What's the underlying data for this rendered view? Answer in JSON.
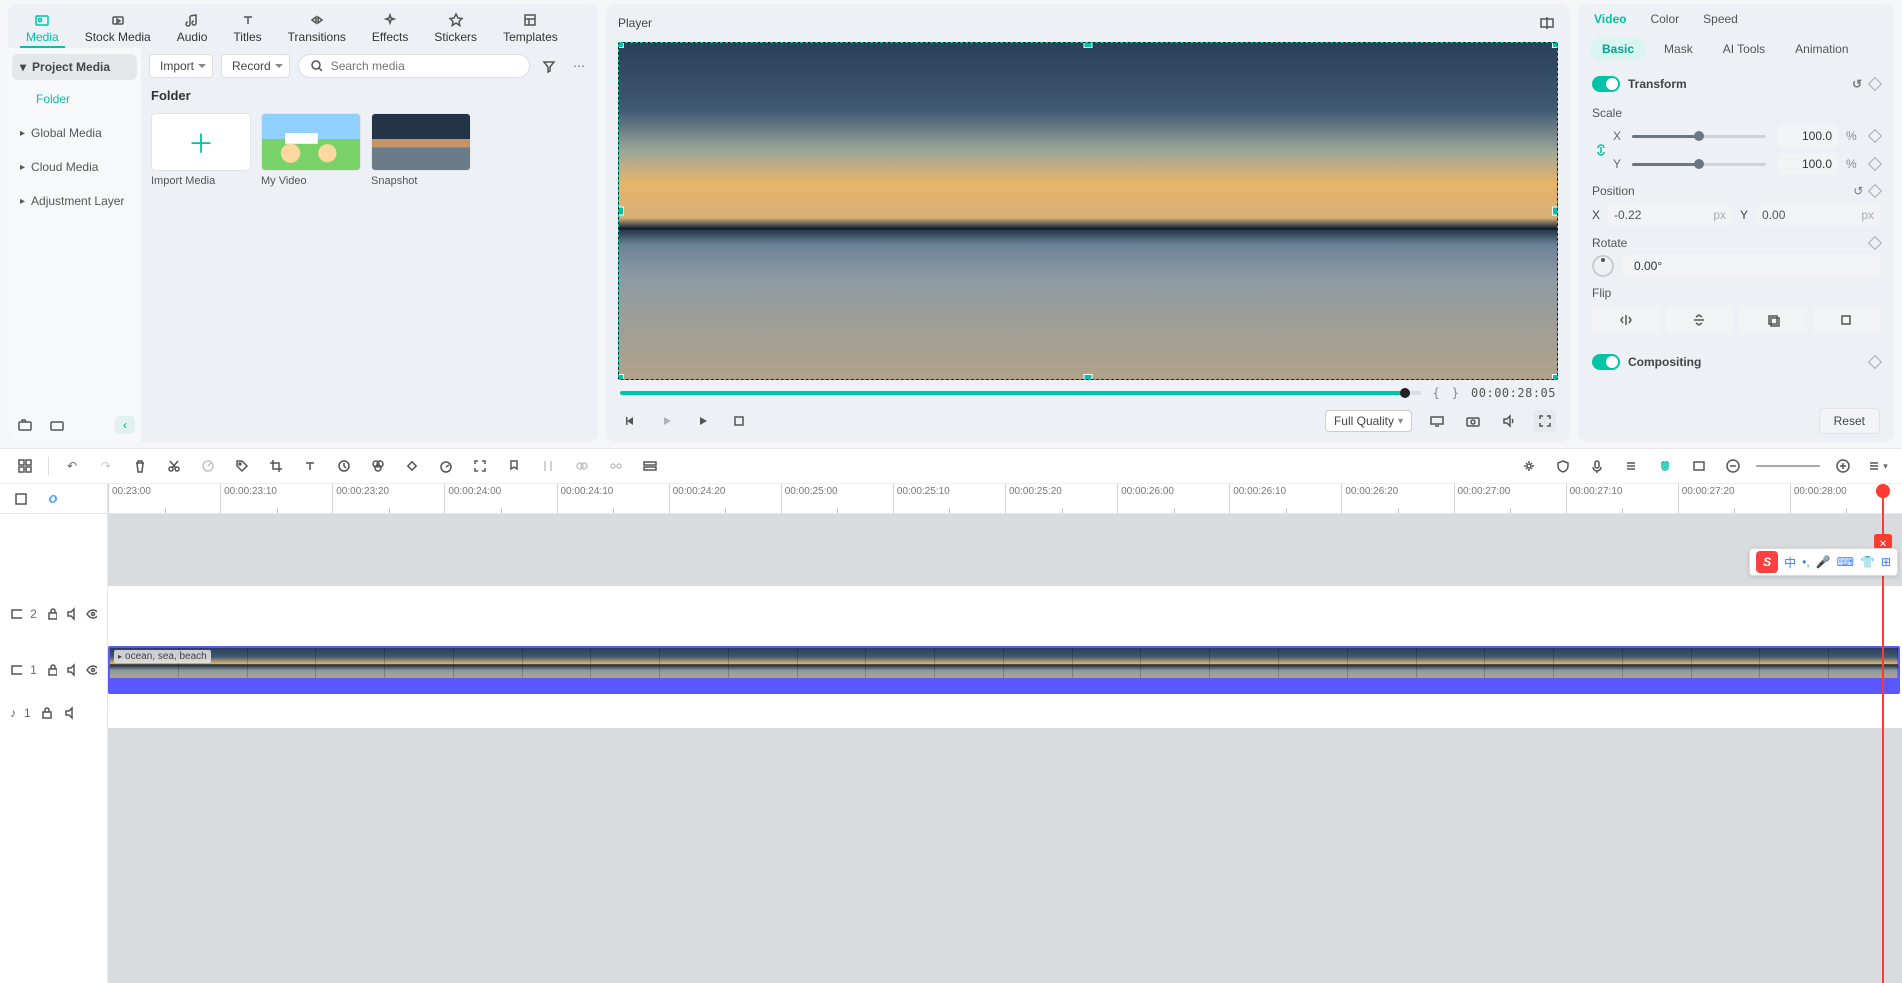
{
  "topTabs": [
    {
      "key": "media",
      "label": "Media"
    },
    {
      "key": "stock",
      "label": "Stock Media"
    },
    {
      "key": "audio",
      "label": "Audio"
    },
    {
      "key": "titles",
      "label": "Titles"
    },
    {
      "key": "transitions",
      "label": "Transitions"
    },
    {
      "key": "effects",
      "label": "Effects"
    },
    {
      "key": "stickers",
      "label": "Stickers"
    },
    {
      "key": "templates",
      "label": "Templates"
    }
  ],
  "mediaSide": {
    "header": "Project Media",
    "folder": "Folder",
    "links": [
      "Global Media",
      "Cloud Media",
      "Adjustment Layer"
    ]
  },
  "mediaToolbar": {
    "import": "Import",
    "record": "Record",
    "searchPlaceholder": "Search media"
  },
  "mediaGrid": {
    "title": "Folder",
    "items": [
      {
        "label": "Import Media",
        "type": "add"
      },
      {
        "label": "My Video",
        "type": "cartoon"
      },
      {
        "label": "Snapshot",
        "type": "sunset"
      }
    ]
  },
  "player": {
    "title": "Player",
    "timecode": "00:00:28:05",
    "quality": "Full Quality"
  },
  "propsTabs": [
    "Video",
    "Color",
    "Speed"
  ],
  "propsSub": [
    "Basic",
    "Mask",
    "AI Tools",
    "Animation"
  ],
  "transform": {
    "title": "Transform",
    "scaleLabel": "Scale",
    "scaleX": "100.0",
    "scaleY": "100.0",
    "scaleUnit": "%",
    "positionLabel": "Position",
    "posX": "-0.22",
    "posY": "0.00",
    "posUnit": "px",
    "rotateLabel": "Rotate",
    "rotateVal": "0.00°",
    "flipLabel": "Flip"
  },
  "compositing": {
    "title": "Compositing"
  },
  "resetLabel": "Reset",
  "ruler": [
    "00:23:00",
    "00:00:23:10",
    "00:00:23:20",
    "00:00:24:00",
    "00:00:24:10",
    "00:00:24:20",
    "00:00:25:00",
    "00:00:25:10",
    "00:00:25:20",
    "00:00:26:00",
    "00:00:26:10",
    "00:00:26:20",
    "00:00:27:00",
    "00:00:27:10",
    "00:00:27:20",
    "00:00:28:00"
  ],
  "clip": {
    "label": "ocean, sea, beach"
  },
  "trackHead": {
    "video2": "2",
    "video1": "1",
    "audio1": "1"
  },
  "ime": {
    "lang": "中"
  }
}
